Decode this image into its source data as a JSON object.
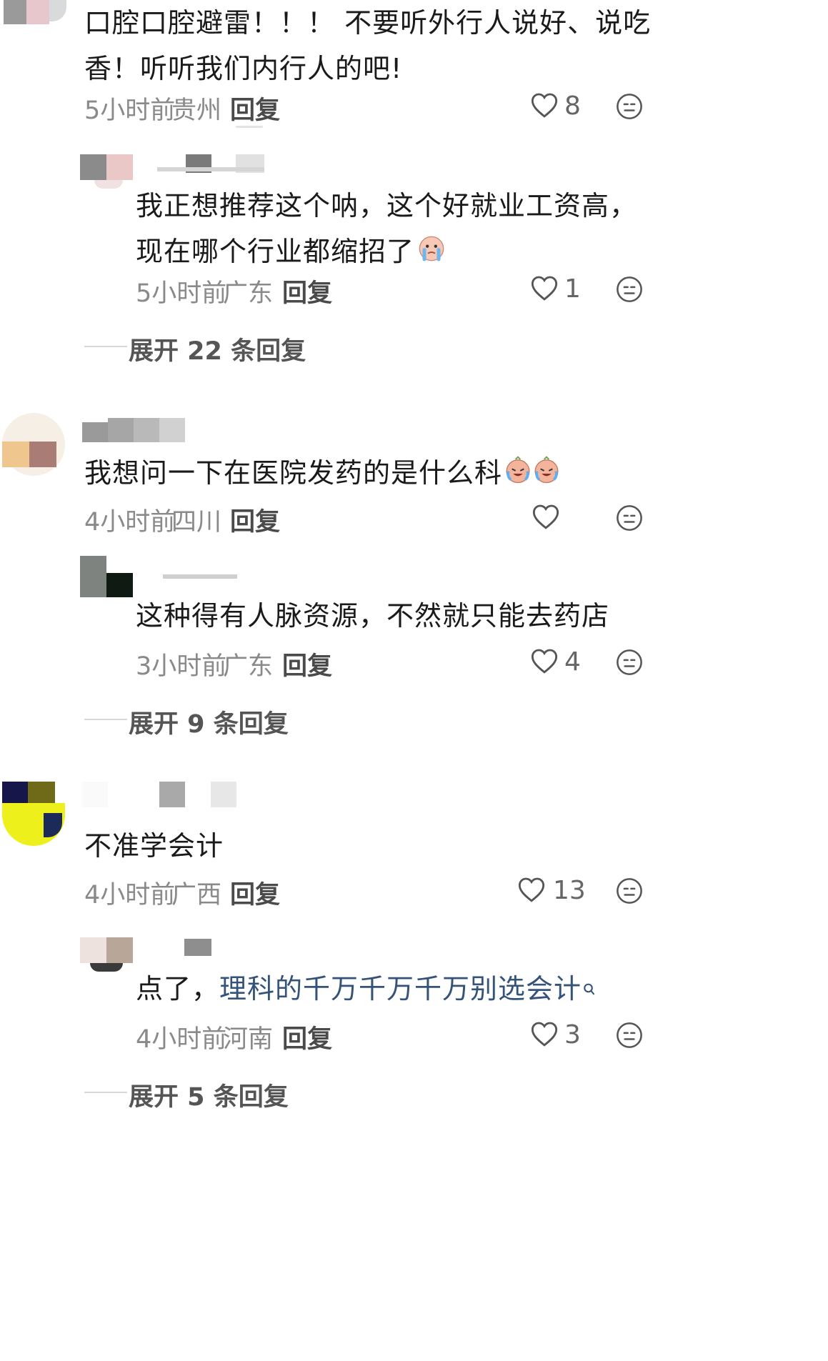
{
  "comments": [
    {
      "text": "口腔口腔避雷！！！ 不要听外行人说好、说吃香！听听我们内行人的吧!",
      "time": "5小时前",
      "location": "贵州",
      "reply_label": "回复",
      "likes": "8",
      "reply": {
        "text": "我正想推荐这个呐，这个好就业工资高，现在哪个行业都缩招了",
        "time": "5小时前",
        "location": "广东",
        "reply_label": "回复",
        "likes": "1"
      },
      "expand_label": "展开 22 条回复"
    },
    {
      "text": "我想问一下在医院发药的是什么科",
      "time": "4小时前",
      "location": "四川",
      "reply_label": "回复",
      "likes": "",
      "reply": {
        "text": "这种得有人脉资源，不然就只能去药店",
        "time": "3小时前",
        "location": "广东",
        "reply_label": "回复",
        "likes": "4"
      },
      "expand_label": "展开 9 条回复"
    },
    {
      "text": "不准学会计",
      "time": "4小时前",
      "location": "广西",
      "reply_label": "回复",
      "likes": "13",
      "reply": {
        "text_prefix": "点了，",
        "text_link": "理科的千万千万千万别选会计",
        "time": "4小时前",
        "location": "河南",
        "reply_label": "回复",
        "likes": "3"
      },
      "expand_label": "展开 5 条回复"
    }
  ],
  "icons": {
    "like": "heart-outline-icon",
    "emoji": "neutral-face-icon",
    "emoji_inline": [
      "crying-face-icon",
      "laughing-crying-face-icon",
      "search-icon"
    ]
  },
  "colors": {
    "text": "#1a1a1a",
    "meta": "#8a8a8a",
    "link": "#34537a",
    "icon": "#555555"
  }
}
